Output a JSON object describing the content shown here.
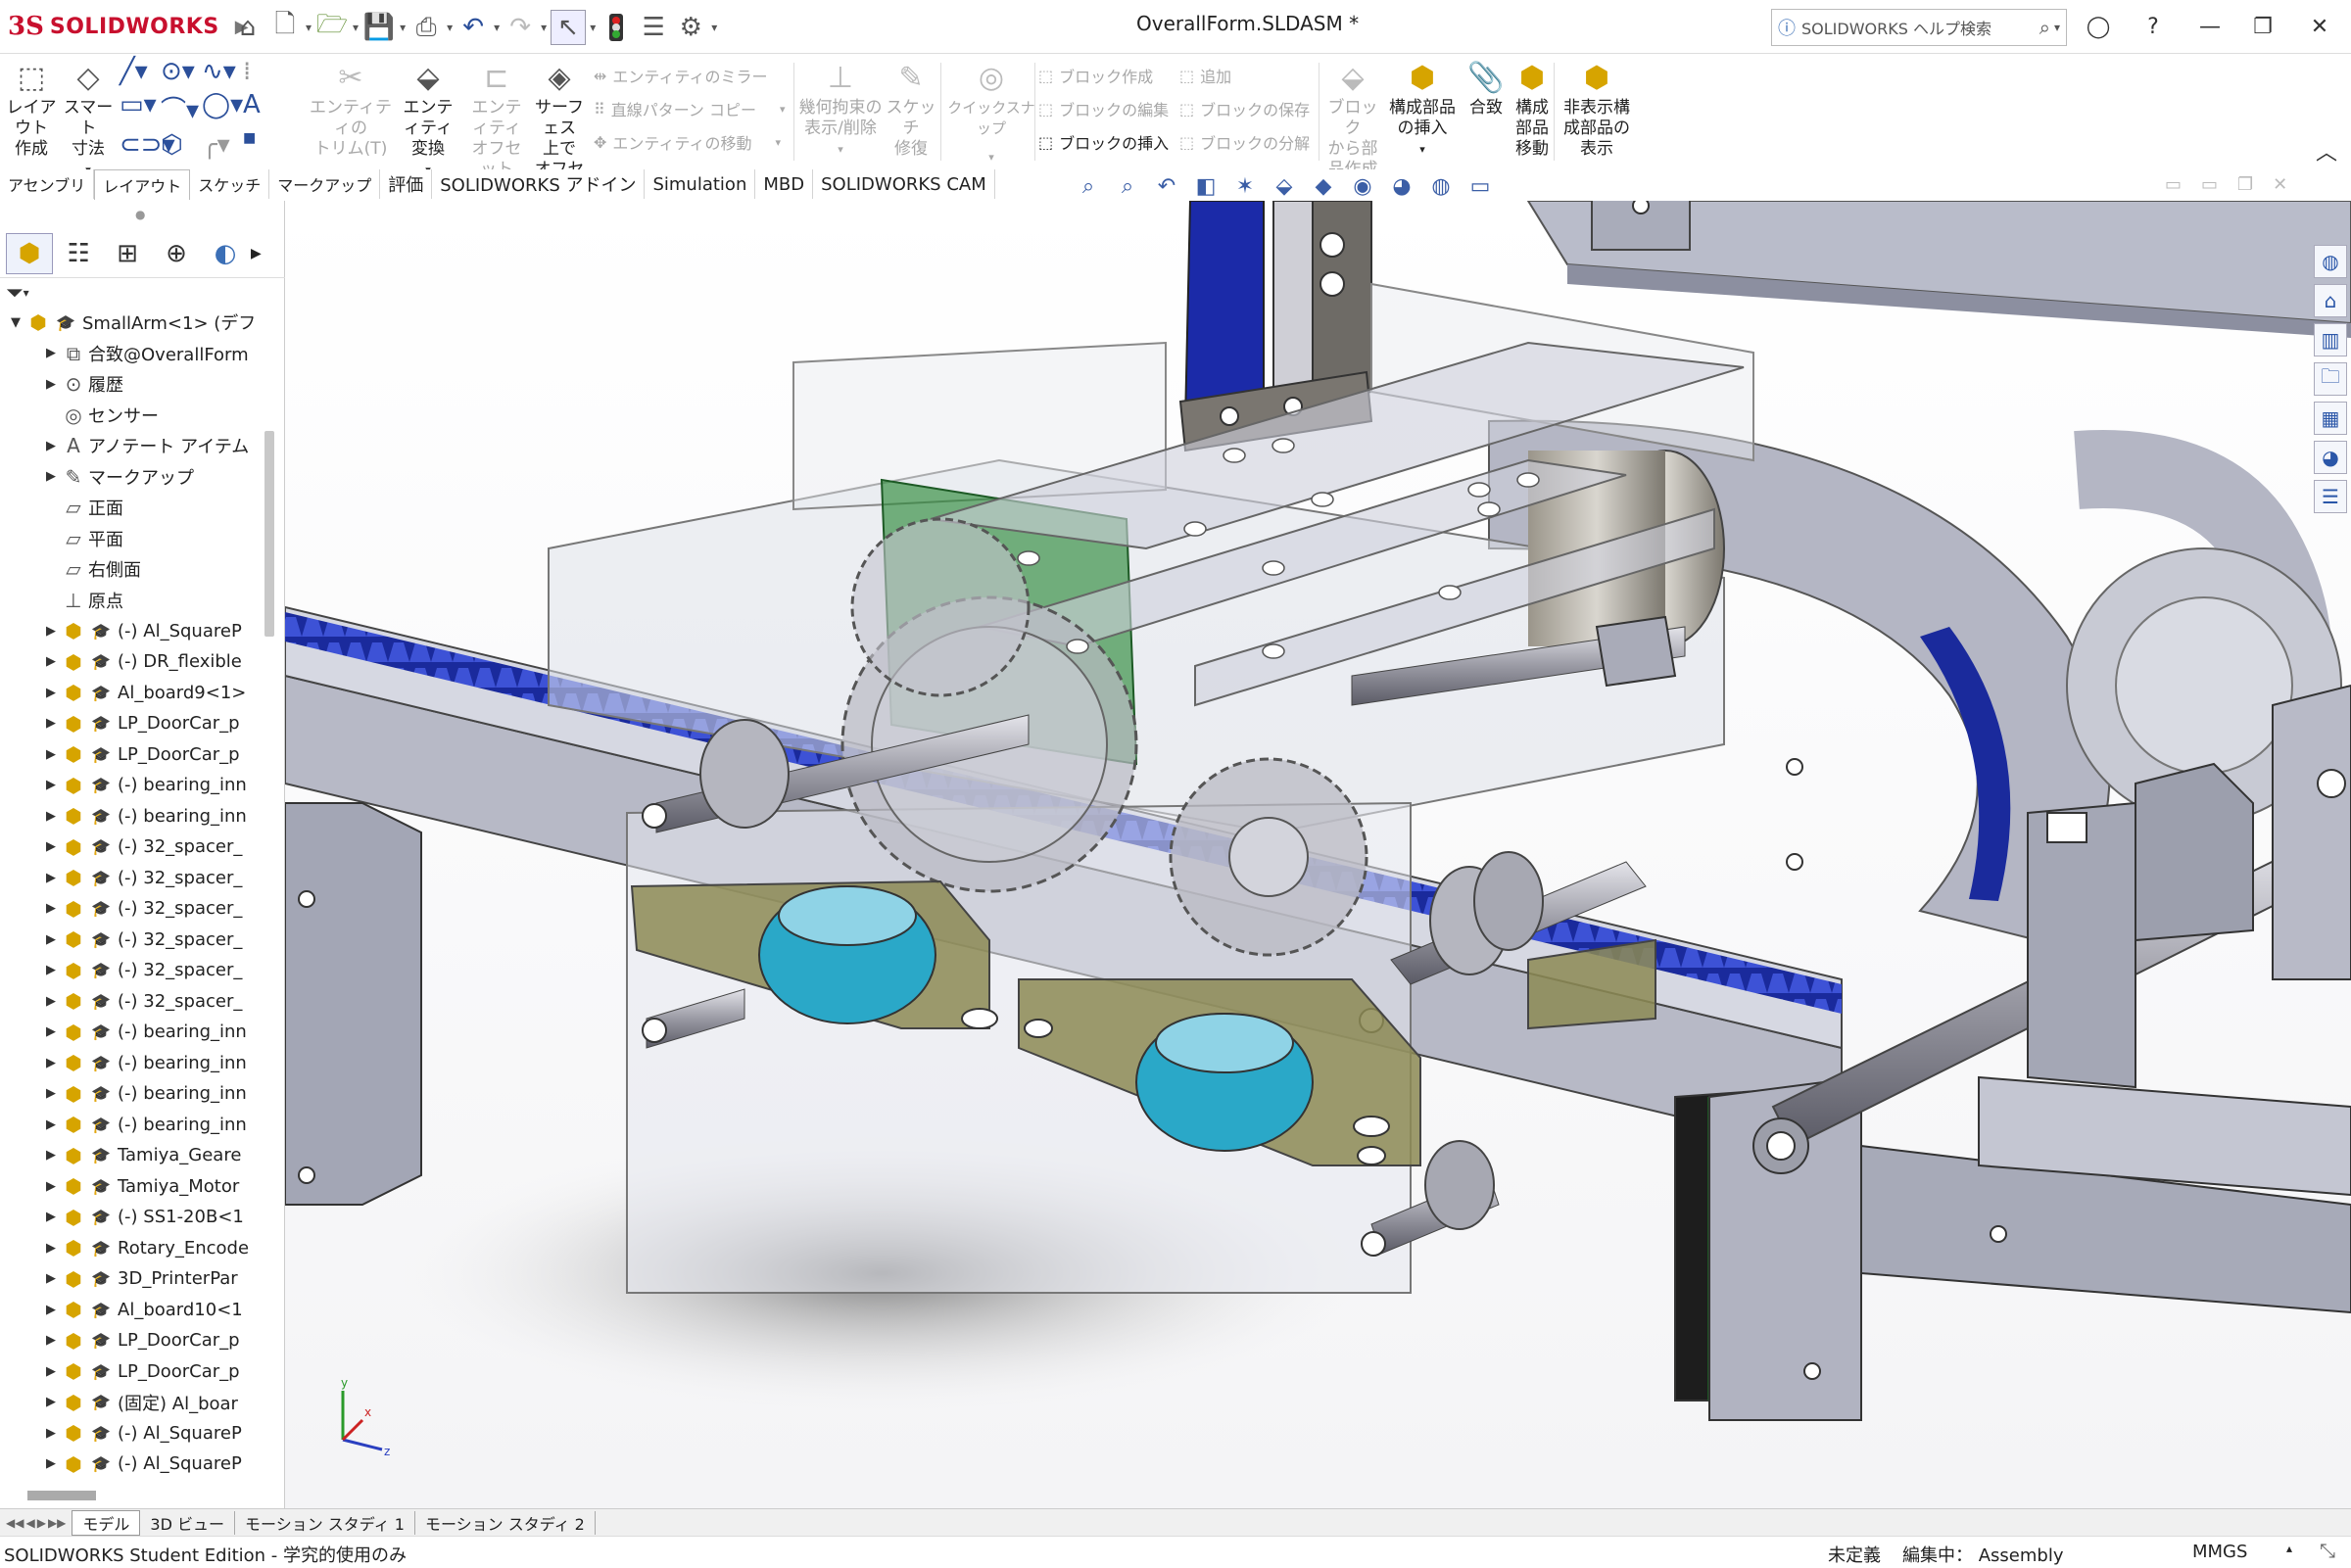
{
  "app": {
    "logo_ds": "3S",
    "logo_text": "SOLIDWORKS",
    "document_title": "OverallForm.SLDASM *",
    "search_placeholder": "SOLIDWORKS ヘルプ検索"
  },
  "ribbon": {
    "layout_create": [
      "レイアウト",
      "作成"
    ],
    "smart_dim": [
      "スマート",
      "寸法"
    ],
    "entity_trim": [
      "エンティティの",
      "トリム(T)"
    ],
    "entity_convert": [
      "エンティティ",
      "変換"
    ],
    "entity_offset": [
      "エンティティ",
      "オフセット"
    ],
    "surface_offset": [
      "サーフェス",
      "上で",
      "オフセット"
    ],
    "mirror": "エンティティのミラー",
    "linear_pattern": "直線パターン コピー",
    "entity_move": "エンティティの移動",
    "geom_relations": [
      "幾何拘束の",
      "表示/削除"
    ],
    "sketch_repair": [
      "スケッチ",
      "修復"
    ],
    "quick_snap": "クイックスナップ",
    "block_create": "ブロック作成",
    "block_edit": "ブロックの編集",
    "block_insert": "ブロックの挿入",
    "block_add": "追加",
    "block_save": "ブロックの保存",
    "block_explode": "ブロックの分解",
    "block_to_part": [
      "ブロック",
      "から部",
      "品作成"
    ],
    "insert_component": [
      "構成部品",
      "の挿入"
    ],
    "mate": "合致",
    "move_component": [
      "構成",
      "部品",
      "移動"
    ],
    "show_hidden": [
      "非表示構",
      "成部品の",
      "表示"
    ]
  },
  "tabs": [
    "アセンブリ",
    "レイアウト",
    "スケッチ",
    "マークアップ",
    "評価",
    "SOLIDWORKS アドイン",
    "Simulation",
    "MBD",
    "SOLIDWORKS CAM"
  ],
  "active_tab": "レイアウト",
  "tree": [
    {
      "label": "SmallArm<1> (デフ",
      "icon": "assembly-icon",
      "expand": "▼",
      "level": 0
    },
    {
      "label": "合致@OverallForm",
      "icon": "mate-folder-icon",
      "expand": "▶",
      "level": 1
    },
    {
      "label": "履歴",
      "icon": "history-icon",
      "expand": "▶",
      "level": 1
    },
    {
      "label": "センサー",
      "icon": "sensor-icon",
      "expand": "",
      "level": 1
    },
    {
      "label": "アノテート アイテム",
      "icon": "annotation-icon",
      "expand": "▶",
      "level": 1
    },
    {
      "label": "マークアップ",
      "icon": "markup-icon",
      "expand": "▶",
      "level": 1
    },
    {
      "label": "正面",
      "icon": "plane-icon",
      "expand": "",
      "level": 1
    },
    {
      "label": "平面",
      "icon": "plane-icon",
      "expand": "",
      "level": 1
    },
    {
      "label": "右側面",
      "icon": "plane-icon",
      "expand": "",
      "level": 1
    },
    {
      "label": "原点",
      "icon": "origin-icon",
      "expand": "",
      "level": 1
    },
    {
      "label": "(-) Al_SquareP",
      "icon": "part-icon",
      "expand": "▶",
      "level": 1
    },
    {
      "label": "(-) DR_flexible",
      "icon": "part-icon",
      "expand": "▶",
      "level": 1
    },
    {
      "label": "Al_board9<1>",
      "icon": "part-icon",
      "expand": "▶",
      "level": 1
    },
    {
      "label": "LP_DoorCar_p",
      "icon": "part-icon",
      "expand": "▶",
      "level": 1
    },
    {
      "label": "LP_DoorCar_p",
      "icon": "part-icon",
      "expand": "▶",
      "level": 1
    },
    {
      "label": "(-) bearing_inn",
      "icon": "part-icon",
      "expand": "▶",
      "level": 1
    },
    {
      "label": "(-) bearing_inn",
      "icon": "part-icon",
      "expand": "▶",
      "level": 1
    },
    {
      "label": "(-) 32_spacer_",
      "icon": "part-icon",
      "expand": "▶",
      "level": 1
    },
    {
      "label": "(-) 32_spacer_",
      "icon": "part-icon",
      "expand": "▶",
      "level": 1
    },
    {
      "label": "(-) 32_spacer_",
      "icon": "part-icon",
      "expand": "▶",
      "level": 1
    },
    {
      "label": "(-) 32_spacer_",
      "icon": "part-icon",
      "expand": "▶",
      "level": 1
    },
    {
      "label": "(-) 32_spacer_",
      "icon": "part-icon",
      "expand": "▶",
      "level": 1
    },
    {
      "label": "(-) 32_spacer_",
      "icon": "part-icon",
      "expand": "▶",
      "level": 1
    },
    {
      "label": "(-) bearing_inn",
      "icon": "part-icon",
      "expand": "▶",
      "level": 1
    },
    {
      "label": "(-) bearing_inn",
      "icon": "part-icon",
      "expand": "▶",
      "level": 1
    },
    {
      "label": "(-) bearing_inn",
      "icon": "part-icon",
      "expand": "▶",
      "level": 1
    },
    {
      "label": "(-) bearing_inn",
      "icon": "part-icon",
      "expand": "▶",
      "level": 1
    },
    {
      "label": "Tamiya_Geare",
      "icon": "part-icon",
      "expand": "▶",
      "level": 1
    },
    {
      "label": "Tamiya_Motor",
      "icon": "part-icon",
      "expand": "▶",
      "level": 1
    },
    {
      "label": "(-) SS1-20B<1",
      "icon": "part-icon",
      "expand": "▶",
      "level": 1
    },
    {
      "label": "Rotary_Encode",
      "icon": "part-icon",
      "expand": "▶",
      "level": 1
    },
    {
      "label": "3D_PrinterPar",
      "icon": "part-icon",
      "expand": "▶",
      "level": 1
    },
    {
      "label": "Al_board10<1",
      "icon": "part-icon",
      "expand": "▶",
      "level": 1
    },
    {
      "label": "LP_DoorCar_p",
      "icon": "part-icon",
      "expand": "▶",
      "level": 1
    },
    {
      "label": "LP_DoorCar_p",
      "icon": "part-icon",
      "expand": "▶",
      "level": 1
    },
    {
      "label": "(固定) Al_boar",
      "icon": "part-icon",
      "expand": "▶",
      "level": 1
    },
    {
      "label": "(-) Al_SquareP",
      "icon": "part-icon",
      "expand": "▶",
      "level": 1
    },
    {
      "label": "(-) Al_SquareP",
      "icon": "part-icon",
      "expand": "▶",
      "level": 1
    }
  ],
  "bottom_tabs": [
    "モデル",
    "3D ビュー",
    "モーション スタディ 1",
    "モーション スタディ 2"
  ],
  "status": {
    "left": "SOLIDWORKS Student Edition - 学究的使用のみ",
    "defined": "未定義",
    "editing": "編集中： Assembly",
    "units": "MMGS"
  },
  "triad": {
    "x": "x",
    "y": "y",
    "z": "z"
  },
  "colors": {
    "brand": "#c8102e",
    "rack_blue": "#1a2a9c",
    "bearing_cyan": "#2aa8c8",
    "frame_gray": "#b9bccb"
  }
}
